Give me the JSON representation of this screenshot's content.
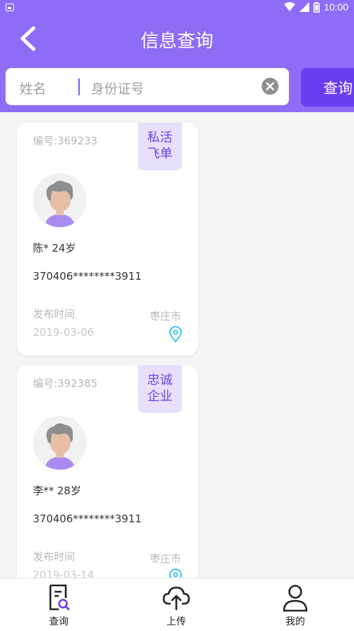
{
  "statusbar": {
    "time": "10:00"
  },
  "header": {
    "title": "信息查询"
  },
  "search": {
    "name_placeholder": "姓名",
    "id_placeholder": "身份证号",
    "button_label": "查询"
  },
  "records": [
    {
      "number": "编号:369233",
      "tag": [
        "私活",
        "飞单"
      ],
      "person": "陈* 24岁",
      "id_number": "370406********3911",
      "publish_label": "发布时间",
      "publish_date": "2019-03-06",
      "city": "枣庄市"
    },
    {
      "number": "编号:392385",
      "tag": [
        "忠诚",
        "企业"
      ],
      "person": "李** 28岁",
      "id_number": "370406********3911",
      "publish_label": "发布时间",
      "publish_date": "2019-03-14",
      "city": "枣庄市"
    }
  ],
  "tabbar": [
    {
      "label": "查询",
      "icon": "document-search-icon"
    },
    {
      "label": "上传",
      "icon": "cloud-upload-icon"
    },
    {
      "label": "我的",
      "icon": "user-icon"
    }
  ],
  "colors": {
    "primary": "#8f6cf6",
    "button": "#6b3df0",
    "tag_bg": "#e6e0fb",
    "pin": "#3cc6e6"
  }
}
